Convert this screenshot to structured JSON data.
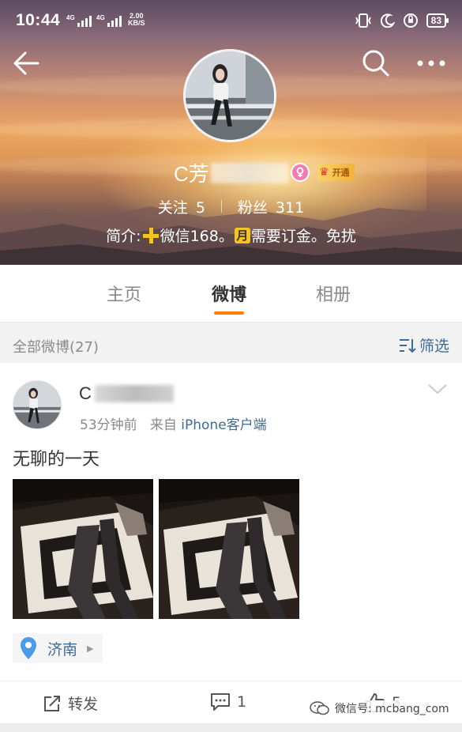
{
  "status_bar": {
    "time": "10:44",
    "signal_1": "4G",
    "signal_2": "4G",
    "speed_value": "2.00",
    "speed_unit": "KB/S",
    "battery": "83"
  },
  "profile": {
    "name_visible": "C芳",
    "vip_label": "开通",
    "following_label": "关注",
    "following_count": "5",
    "followers_label": "粉丝",
    "followers_count": "311",
    "bio_prefix": "简介:",
    "bio_middle": "微信​168。",
    "bio_month": "月",
    "bio_suffix": "需要订金。免扰"
  },
  "tabs": [
    {
      "label": "主页",
      "active": false
    },
    {
      "label": "微博",
      "active": true
    },
    {
      "label": "相册",
      "active": false
    }
  ],
  "filter": {
    "title": "全部微博(27)",
    "button_label": "筛选"
  },
  "post": {
    "user_visible": "C",
    "time": "53分钟前",
    "from_label": "来自",
    "source": "iPhone客户端",
    "text": "无聊的一天",
    "location": "济南",
    "repost_label": "转发",
    "comment_count": "1",
    "like_count": "5"
  },
  "watermark": "微信号: mcbang_com",
  "colors": {
    "accent": "#ff8200",
    "link": "#3f6b96",
    "vip_gold": "#f3b13b",
    "female_pink": "#f27bb0"
  },
  "icons": [
    "back-arrow-icon",
    "search-icon",
    "more-icon",
    "female-icon",
    "crown-icon",
    "filter-icon",
    "chevron-down-icon",
    "location-pin-icon",
    "repost-icon",
    "comment-icon",
    "like-icon"
  ]
}
